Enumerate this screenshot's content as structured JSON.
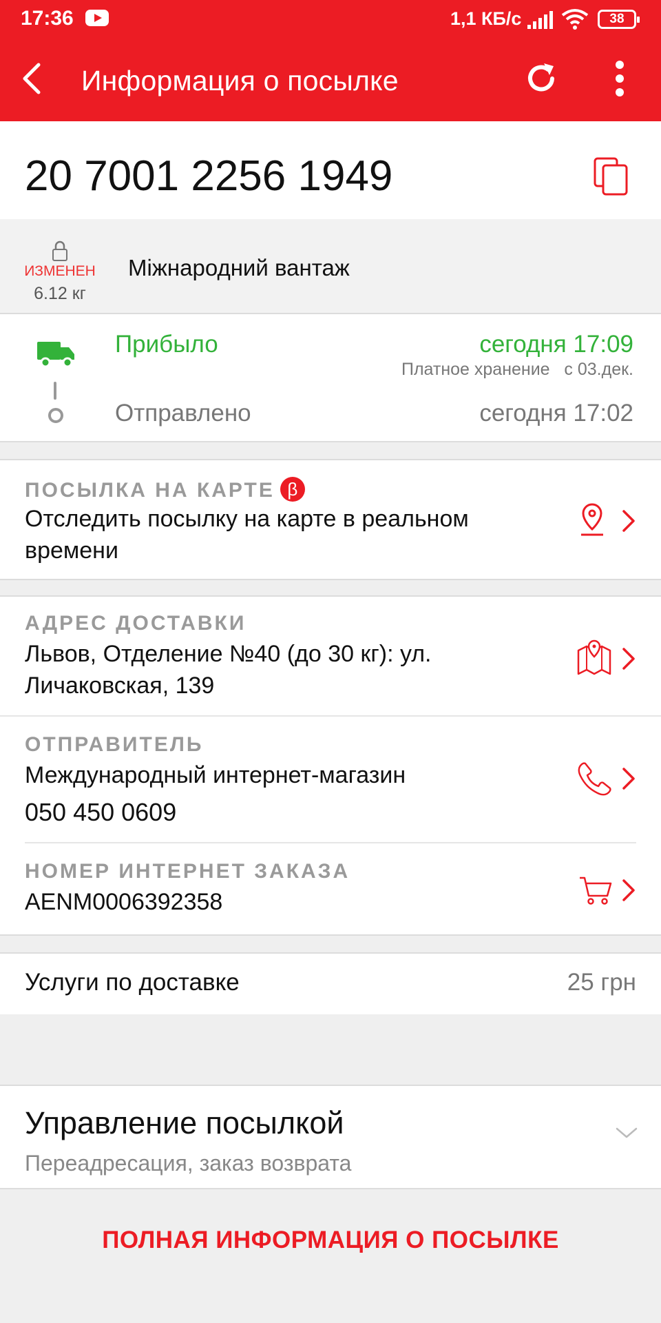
{
  "status_bar": {
    "time": "17:36",
    "speed": "1,1 КБ/с",
    "battery": "38"
  },
  "header": {
    "title": "Информация о посылке",
    "back_icon": "back-arrow-icon",
    "refresh_icon": "refresh-icon",
    "more_icon": "more-vertical-icon",
    "color": "#ec1c24"
  },
  "tracking": {
    "number": "20 7001 2256 1949"
  },
  "package": {
    "changed_label": "ИЗМЕНЕН",
    "weight": "6.12 кг",
    "type": "Міжнародний вантаж"
  },
  "history": {
    "current": {
      "status": "Прибыло",
      "time": "сегодня 17:09",
      "note": "Платное хранение   с 03.дек."
    },
    "previous": {
      "status": "Отправлено",
      "time": "сегодня 17:02"
    },
    "active_color": "#33b23a"
  },
  "map_card": {
    "label": "ПОСЫЛКА НА КАРТЕ",
    "badge": "β",
    "text": "Отследить посылку на карте в реальном времени"
  },
  "address": {
    "label": "АДРЕС ДОСТАВКИ",
    "text": "Львов, Отделение №40 (до 30 кг): ул. Личаковская, 139"
  },
  "sender": {
    "label": "ОТПРАВИТЕЛЬ",
    "name": "Международный интернет-магазин",
    "phone": "050 450 0609"
  },
  "order": {
    "label": "НОМЕР ИНТЕРНЕТ ЗАКАЗА",
    "number": "AENM0006392358"
  },
  "services": {
    "label": "Услуги по доставке",
    "price": "25 грн"
  },
  "manage": {
    "title": "Управление посылкой",
    "subtitle": "Переадресация, заказ возврата"
  },
  "full_info": {
    "label": "ПОЛНАЯ ИНФОРМАЦИЯ О ПОСЫЛКЕ"
  }
}
